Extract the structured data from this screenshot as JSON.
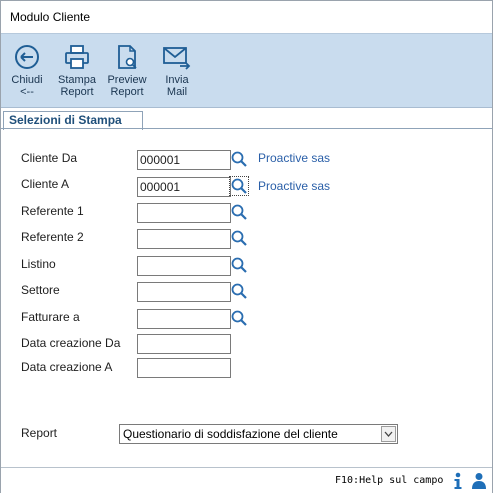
{
  "window": {
    "title": "Modulo Cliente"
  },
  "toolbar": {
    "close_label": "Chiudi\n<--",
    "print_label": "Stampa\nReport",
    "preview_label": "Preview\nReport",
    "mail_label": "Invia\nMail"
  },
  "tab": {
    "label": "Selezioni di Stampa"
  },
  "form": {
    "cliente_da": {
      "label": "Cliente Da",
      "value": "000001",
      "desc": "Proactive sas"
    },
    "cliente_a": {
      "label": "Cliente A",
      "value": "000001",
      "desc": "Proactive sas"
    },
    "referente1": {
      "label": "Referente 1",
      "value": ""
    },
    "referente2": {
      "label": "Referente 2",
      "value": ""
    },
    "listino": {
      "label": "Listino",
      "value": ""
    },
    "settore": {
      "label": "Settore",
      "value": ""
    },
    "fatturare": {
      "label": "Fatturare a",
      "value": ""
    },
    "data_da": {
      "label": "Data creazione Da",
      "value": ""
    },
    "data_a": {
      "label": "Data creazione A",
      "value": ""
    },
    "report": {
      "label": "Report",
      "value": "Questionario di soddisfazione del cliente"
    }
  },
  "status": {
    "help": "F10:Help sul campo"
  },
  "colors": {
    "toolbar_bg": "#c9dcee",
    "accent": "#2a5fa8",
    "tab_text": "#1f4f7a"
  }
}
